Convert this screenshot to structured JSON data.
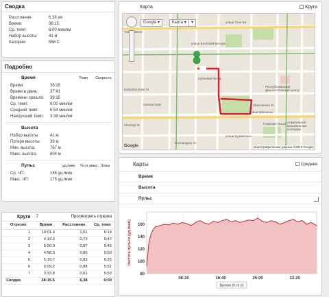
{
  "summary": {
    "title": "Сводка",
    "rows": [
      {
        "label": "Расстояние:",
        "value": "6,38 км"
      },
      {
        "label": "Время:",
        "value": "38:15"
      },
      {
        "label": "Ср. темп:",
        "value": "6:00 мин/км"
      },
      {
        "label": "Набор высоты:",
        "value": "41 м"
      },
      {
        "label": "Калории:",
        "value": "558 C"
      }
    ]
  },
  "detail": {
    "title": "Подробно",
    "time_section": {
      "title": "Время",
      "col_pace": "Темп",
      "col_speed": "Скорость",
      "rows": [
        {
          "label": "Время:",
          "value": "38:15"
        },
        {
          "label": "Время в движ.:",
          "value": "37:41"
        },
        {
          "label": "Времени прошло:",
          "value": "38:15"
        },
        {
          "label": "Ср. темп:",
          "value": "6:00 мин/км"
        },
        {
          "label": "Средний темп:",
          "value": "5:54 мин/км"
        },
        {
          "label": "Наилучший темп:",
          "value": "3:38 мин/км"
        }
      ]
    },
    "elevation_section": {
      "title": "Высота",
      "rows": [
        {
          "label": "Набор высоты:",
          "value": "41 м"
        },
        {
          "label": "Потеря высоты:",
          "value": "38 м"
        },
        {
          "label": "Мин. высота:",
          "value": "767 м"
        },
        {
          "label": "Макс. высота:",
          "value": "804 м"
        }
      ]
    },
    "pulse_section": {
      "title": "Пульс",
      "col1": "уд./мин",
      "col2": "% от макс.",
      "col3": "Зоны",
      "rows": [
        {
          "label": "Ср. ЧП:",
          "value": "165 уд./мин"
        },
        {
          "label": "Макс. ЧП:",
          "value": "175 уд./мин"
        }
      ]
    }
  },
  "laps": {
    "title": "Круги",
    "count": "7",
    "view_link": "Просмотреть отрезки",
    "headers": [
      "Отрезок",
      "Время",
      "Расстояние",
      "Ср. темп"
    ],
    "rows": [
      [
        "1",
        "10:01.4",
        "1,61",
        "6:14"
      ],
      [
        "2",
        "4:13.2",
        "0,73",
        "5:47"
      ],
      [
        "3",
        "5:00.0",
        "0,87",
        "5:45"
      ],
      [
        "4",
        "4:58.3",
        "0,85",
        "5:50"
      ],
      [
        "5",
        "5:19.7",
        "0,83",
        "6:25"
      ],
      [
        "6",
        "5:09.2",
        "0,88",
        "5:51"
      ],
      [
        "7",
        "3:33.8",
        "0,61",
        "5:53"
      ]
    ],
    "total": [
      "Сводка",
      "38:15.5",
      "6,38",
      "6:00"
    ]
  },
  "map": {
    "title": "Карта",
    "laps_toggle": "Круги",
    "google_btn": "Google",
    "map_btn": "Карта",
    "attribution": "Картографические данные ©2013 Google",
    "streets": [
      "Tole Bi Street",
      "улица Толе Би",
      "улица Богенбай Батыра",
      "Kabanbai Batyr St",
      "Кабанбай батыр",
      "улица Шевченко",
      "Kurmangazy St",
      "улица Курмангазы",
      "Zhambyl St",
      "Гимназия №134",
      "Республиканский Диагностический Центр",
      "Shevchenko St",
      "Алматинские музыкальные колледжи",
      "Karasai batyr"
    ]
  },
  "charts": {
    "title": "Карты",
    "avg_label": "Средняя",
    "rows": [
      "Время",
      "Высота",
      "Пульс"
    ],
    "ylabel": "Частота пульса (уд./мин)",
    "xlabel": "Время (h:m:s)",
    "color": "#c0282d"
  },
  "chart_data": {
    "type": "area",
    "ylabel": "Частота пульса (уд./мин)",
    "xlabel": "Время (h:m:s)",
    "ylim": [
      80,
      180
    ],
    "yticks": [
      80,
      100,
      120,
      140,
      160
    ],
    "xticks": [
      "08:20",
      "16:40",
      "25:00",
      "33:20"
    ],
    "xlim_sec": [
      0,
      2295
    ],
    "x_sec": [
      0,
      30,
      60,
      90,
      120,
      180,
      240,
      300,
      360,
      420,
      480,
      540,
      600,
      660,
      720,
      780,
      840,
      900,
      960,
      1020,
      1080,
      1140,
      1200,
      1260,
      1320,
      1380,
      1440,
      1500,
      1560,
      1620,
      1680,
      1740,
      1800,
      1860,
      1920,
      1980,
      2040,
      2100,
      2160,
      2220,
      2295
    ],
    "values": [
      92,
      130,
      145,
      152,
      156,
      158,
      160,
      159,
      162,
      160,
      163,
      161,
      158,
      163,
      166,
      162,
      160,
      165,
      163,
      166,
      168,
      164,
      166,
      163,
      165,
      167,
      166,
      170,
      165,
      163,
      166,
      164,
      160,
      163,
      166,
      168,
      164,
      166,
      160,
      163,
      158
    ]
  }
}
